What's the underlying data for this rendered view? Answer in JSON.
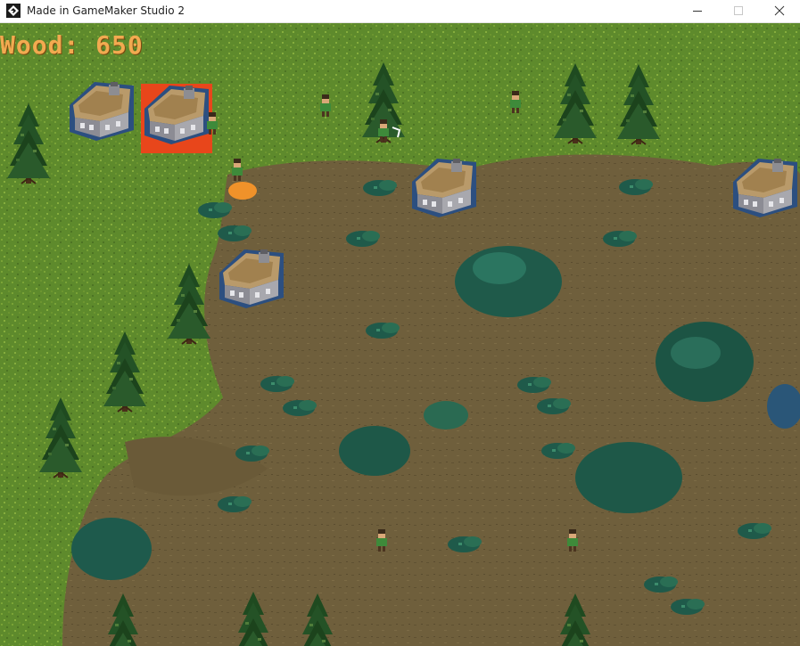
{
  "window": {
    "title": "Made in GameMaker Studio 2",
    "icon": "gamemaker-logo-icon",
    "controls": [
      "minimize-icon",
      "maximize-icon",
      "close-icon"
    ]
  },
  "hud": {
    "wood_text": "Wood: 650"
  },
  "colors": {
    "grass": "#5e8a2c",
    "mud": "#6f5f3c",
    "hud_text": "#f2aa50",
    "selection": "#e8461b",
    "unit_marker": "#f0922a"
  },
  "entities": {
    "houses": 5,
    "selected_house": 1,
    "villagers": 7,
    "trees": 11
  }
}
